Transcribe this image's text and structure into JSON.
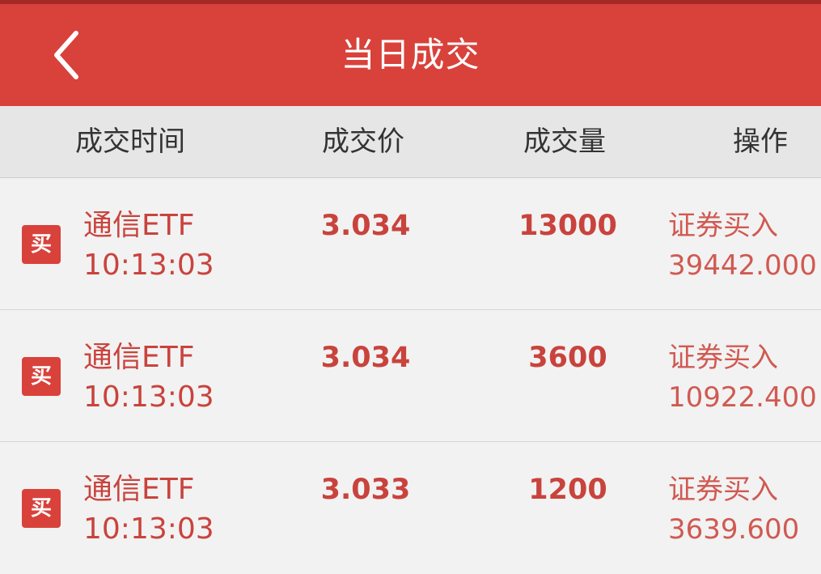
{
  "header": {
    "title": "当日成交",
    "back_icon": "chevron-left-icon"
  },
  "columns": {
    "time": "成交时间",
    "price": "成交价",
    "quantity": "成交量",
    "operation": "操作"
  },
  "colors": {
    "header_bg": "#d8423b",
    "accent_text": "#c9433d",
    "badge_bg": "#d8423b"
  },
  "rows": [
    {
      "badge": "买",
      "name": "通信ETF",
      "time": "10:13:03",
      "price": "3.034",
      "quantity": "13000",
      "action": "证券买入",
      "amount": "39442.000"
    },
    {
      "badge": "买",
      "name": "通信ETF",
      "time": "10:13:03",
      "price": "3.034",
      "quantity": "3600",
      "action": "证券买入",
      "amount": "10922.400"
    },
    {
      "badge": "买",
      "name": "通信ETF",
      "time": "10:13:03",
      "price": "3.033",
      "quantity": "1200",
      "action": "证券买入",
      "amount": "3639.600"
    }
  ]
}
